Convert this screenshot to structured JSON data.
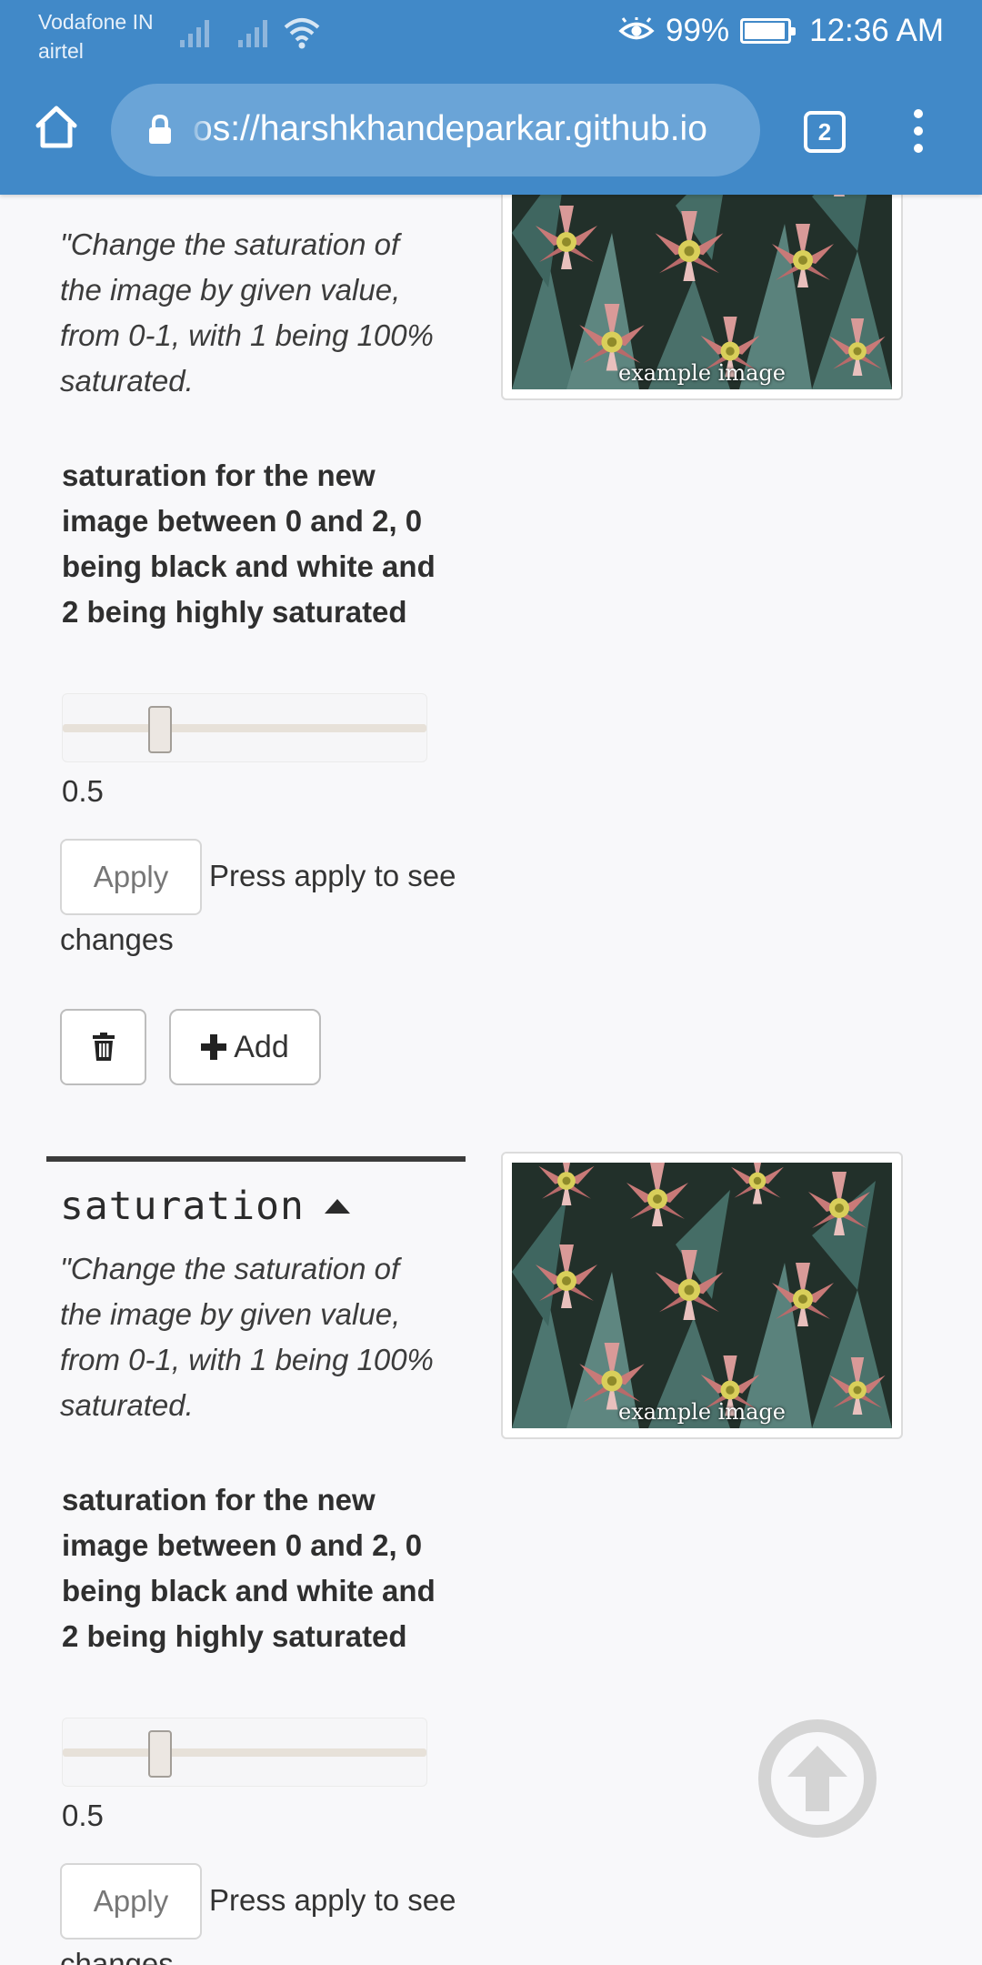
{
  "status_bar": {
    "carrier1": "Vodafone IN",
    "carrier2": "airtel",
    "battery": "99%",
    "time": "12:36 AM"
  },
  "browser": {
    "url": "os://harshkhandeparkar.github.io",
    "tab_count": "2"
  },
  "sections": [
    {
      "description": "\"Change the saturation of the image by given value, from 0-1, with 1 being 100% saturated.",
      "input_label": "saturation for the new image between 0 and 2, 0 being black and white and 2 being highly saturated",
      "slider_value": "0.5",
      "slider_fraction": 0.25,
      "apply_label": "Apply",
      "apply_hint": "Press apply to see changes",
      "add_label": "Add",
      "image_caption": "example image"
    },
    {
      "title": "saturation",
      "description": "\"Change the saturation of the image by given value, from 0-1, with 1 being 100% saturated.",
      "input_label": "saturation for the new image between 0 and 2, 0 being black and white and 2 being highly saturated",
      "slider_value": "0.5",
      "slider_fraction": 0.25,
      "apply_label": "Apply",
      "apply_hint": "Press apply to see changes",
      "image_caption": "example image"
    }
  ],
  "icons": {
    "home": "home-icon",
    "lock": "lock-icon",
    "menu": "more-vert-icon",
    "delete": "trash-icon",
    "add": "plus-icon",
    "collapse": "caret-up-icon",
    "scroll_top": "arrow-up-circle-icon"
  },
  "colors": {
    "toolbar": "#4189c8",
    "urlbar": "#6aa4d7",
    "page_bg": "#f8f8fa",
    "divider": "#3b3b3b"
  }
}
